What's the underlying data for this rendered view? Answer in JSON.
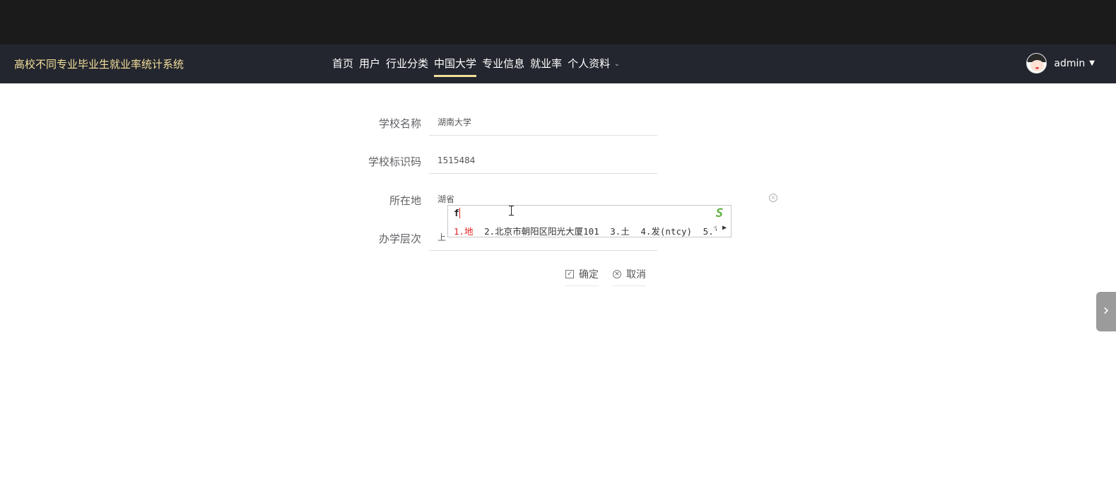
{
  "header": {
    "site_title": "高校不同专业毕业生就业率统计系统",
    "nav": [
      {
        "label": "首页"
      },
      {
        "label": "用户"
      },
      {
        "label": "行业分类"
      },
      {
        "label": "中国大学",
        "active": true
      },
      {
        "label": "专业信息"
      },
      {
        "label": "就业率"
      },
      {
        "label": "个人资料",
        "dropdown": true
      }
    ],
    "user": {
      "name": "admin",
      "caret": "▼"
    },
    "accent_color": "#f3df9b"
  },
  "form": {
    "school_name": {
      "label": "学校名称",
      "value": "湖南大学"
    },
    "school_code": {
      "label": "学校标识码",
      "value": "1515484"
    },
    "location": {
      "label": "所在地",
      "value": "湖省"
    },
    "level": {
      "label": "办学层次",
      "value": "上"
    },
    "confirm_label": "确定",
    "cancel_label": "取消"
  },
  "ime": {
    "input": "f",
    "logo": "S",
    "candidates": [
      "1.地",
      "2.北京市朝阳区阳光大厦101",
      "3.土",
      "4.发(ntcy)",
      "5.'"
    ],
    "prev": "◀",
    "next": "▶"
  },
  "side_tab_icon": "chevron-right-icon"
}
